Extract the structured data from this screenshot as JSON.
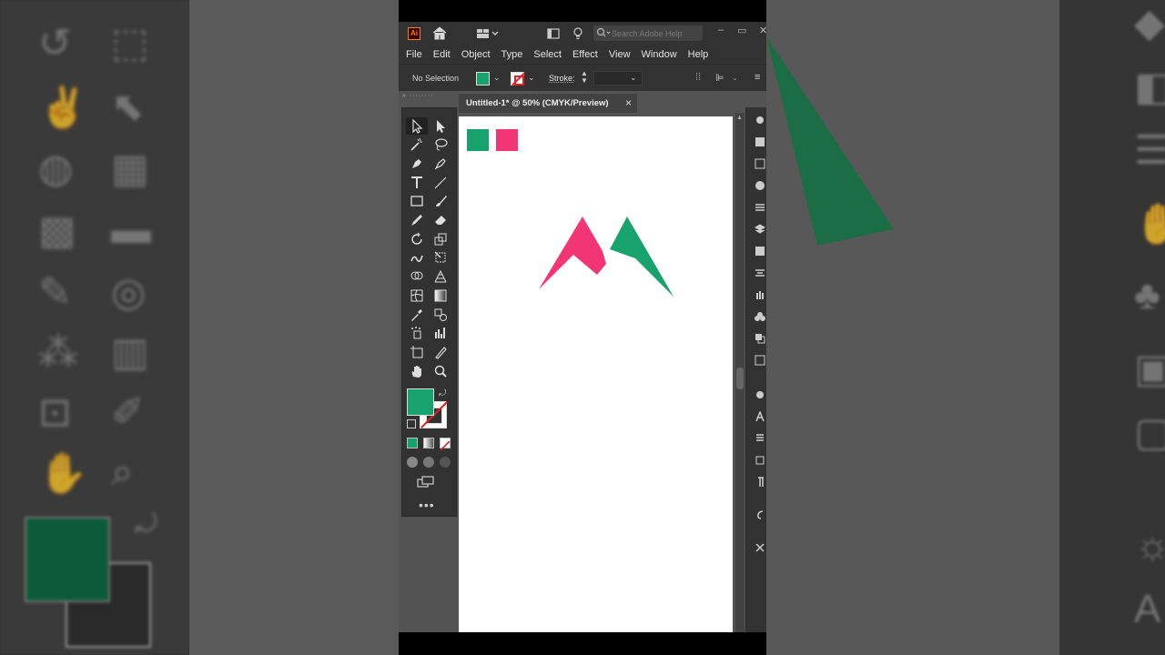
{
  "app": {
    "logo_text": "Ai",
    "search_placeholder": "Search Adobe Help"
  },
  "menu": [
    "File",
    "Edit",
    "Object",
    "Type",
    "Select",
    "Effect",
    "View",
    "Window",
    "Help"
  ],
  "control_bar": {
    "selection_text": "No Selection",
    "stroke_label": "Stroke:",
    "fill_color": "#18a36e"
  },
  "document": {
    "tab_title": "Untitled-1* @ 50% (CMYK/Preview)",
    "close_glyph": "×"
  },
  "colors": {
    "green": "#18a36e",
    "pink": "#f23574",
    "ui_dark": "#323232",
    "canvas_bg": "#ffffff"
  },
  "tools": [
    "selection-tool",
    "direct-selection-tool",
    "magic-wand-tool",
    "lasso-tool",
    "pen-tool",
    "curvature-tool",
    "type-tool",
    "line-segment-tool",
    "rectangle-tool",
    "paintbrush-tool",
    "pencil-tool",
    "eraser-tool",
    "rotate-tool",
    "scale-tool",
    "warp-tool",
    "free-transform-tool",
    "shape-builder-tool",
    "perspective-grid-tool",
    "mesh-tool",
    "gradient-tool",
    "eyedropper-tool",
    "blend-tool",
    "symbol-sprayer-tool",
    "column-graph-tool",
    "artboard-tool",
    "slice-tool",
    "hand-tool",
    "zoom-tool"
  ],
  "more_tools_glyph": "•••"
}
